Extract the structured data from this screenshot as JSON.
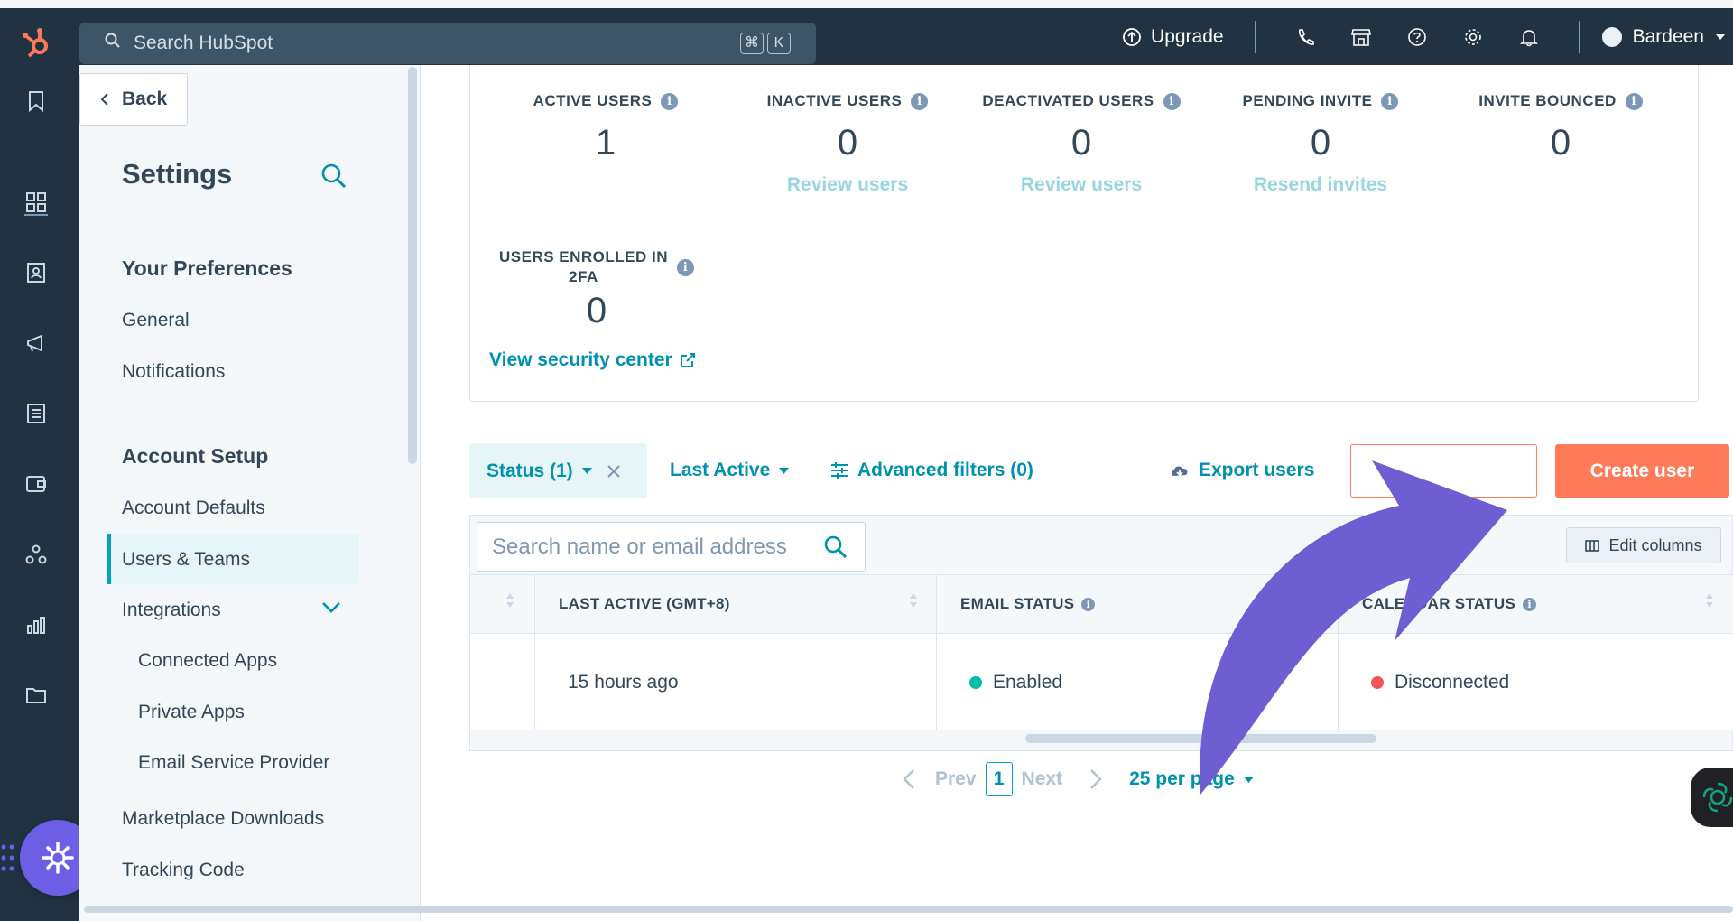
{
  "topbar": {
    "search_placeholder": "Search HubSpot",
    "kbd_cmd": "⌘",
    "kbd_k": "K",
    "upgrade_label": "Upgrade",
    "user_name": "Bardeen"
  },
  "sidebar": {
    "back_label": "Back",
    "title": "Settings",
    "sections": {
      "preferences": "Your Preferences",
      "account_setup": "Account Setup"
    },
    "items": {
      "general": "General",
      "notifications": "Notifications",
      "account_defaults": "Account Defaults",
      "users_teams": "Users & Teams",
      "integrations": "Integrations",
      "connected_apps": "Connected Apps",
      "private_apps": "Private Apps",
      "email_service_provider": "Email Service Provider",
      "marketplace_downloads": "Marketplace Downloads",
      "tracking_code": "Tracking Code"
    }
  },
  "stats": {
    "active": {
      "label": "ACTIVE USERS",
      "value": "1"
    },
    "inactive": {
      "label": "INACTIVE USERS",
      "value": "0",
      "link": "Review users"
    },
    "deactivated": {
      "label": "DEACTIVATED USERS",
      "value": "0",
      "link": "Review users"
    },
    "pending": {
      "label": "PENDING INVITE",
      "value": "0",
      "link": "Resend invites"
    },
    "bounced": {
      "label": "INVITE BOUNCED",
      "value": "0"
    },
    "twofa": {
      "label_line1": "USERS ENROLLED IN",
      "label_line2": "2FA",
      "value": "0"
    },
    "security_link": "View security center"
  },
  "filters": {
    "status": "Status (1)",
    "last_active": "Last Active",
    "advanced": "Advanced filters (0)",
    "export": "Export users",
    "create": "Create user"
  },
  "table": {
    "search_placeholder": "Search name or email address",
    "edit_columns": "Edit columns",
    "headers": {
      "last_active": "LAST ACTIVE (GMT+8)",
      "email_status": "EMAIL STATUS",
      "calendar_status": "CALENDAR STATUS"
    },
    "row": {
      "last_active": "15 hours ago",
      "email_status": "Enabled",
      "calendar_status": "Disconnected"
    },
    "status_colors": {
      "enabled": "#00bda5",
      "disconnected": "#f2545b"
    }
  },
  "pager": {
    "prev": "Prev",
    "page": "1",
    "next": "Next",
    "per_page": "25 per page"
  },
  "colors": {
    "topbar": "#213343",
    "accent": "#ff7a59",
    "link": "#0091ae",
    "annotation_arrow": "#6e5ed2"
  }
}
